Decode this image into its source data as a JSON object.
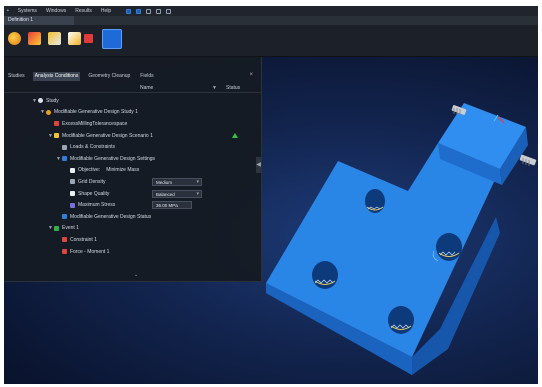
{
  "menubar": {
    "items": [
      "Systems",
      "Windows",
      "Results",
      "Help"
    ]
  },
  "ribbon": {
    "active_tab": "Definition 1"
  },
  "panel": {
    "tabs": [
      "Studies",
      "Analysis Conditions",
      "Geometry Cleanup",
      "Fields"
    ],
    "active_tab_index": 1,
    "close_glyph": "×",
    "columns": {
      "name": "Name",
      "status": "Status",
      "sort_glyph": "▼"
    },
    "collapse_glyph": "◀",
    "more_glyph": "⌄",
    "tree": [
      {
        "label": "Study",
        "indent": 0,
        "twisty": "▼",
        "icon": "study-icon",
        "color": "#d9e1ea"
      },
      {
        "label": "Modifiable Generative Design Study 1",
        "indent": 1,
        "twisty": "▼",
        "icon": "generative-study-icon",
        "color": "#e8a020"
      },
      {
        "label": "ExcessMillingTolerancespace",
        "indent": 2,
        "twisty": "",
        "icon": "tolerance-icon",
        "color": "#e0453a"
      },
      {
        "label": "Modifiable Generative Design Scenario 1",
        "indent": 2,
        "twisty": "▼",
        "icon": "scenario-icon",
        "color": "#f2c230",
        "status": "ok"
      },
      {
        "label": "Loads & Constraints",
        "indent": 3,
        "twisty": "",
        "icon": "loads-icon",
        "color": "#9aa6b4"
      },
      {
        "label": "Modifiable Generative Design Settings",
        "indent": 3,
        "twisty": "▼",
        "icon": "settings-icon",
        "color": "#2f7fd8"
      },
      {
        "label": "Objective:",
        "indent": 4,
        "twisty": "",
        "icon": "objective-icon",
        "color": "#e9eef4",
        "value": "Minimize Mass",
        "value_type": "text"
      },
      {
        "label": "Grid Density",
        "indent": 4,
        "twisty": "",
        "icon": "grid-icon",
        "color": "#9aa6b4",
        "value": "Medium",
        "value_type": "select"
      },
      {
        "label": "Shape Quality",
        "indent": 4,
        "twisty": "",
        "icon": "quality-icon",
        "color": "#e9eef4",
        "value": "Balanced",
        "value_type": "select"
      },
      {
        "label": "Maximum Stress",
        "indent": 4,
        "twisty": "",
        "icon": "stress-icon",
        "color": "#7a6ee0",
        "value": "36.00 MPa",
        "value_type": "input"
      },
      {
        "label": "Modifiable Generative Design Status",
        "indent": 3,
        "twisty": "",
        "icon": "status-icon",
        "color": "#2f7fd8"
      },
      {
        "label": "Event 1",
        "indent": 2,
        "twisty": "▼",
        "icon": "event-icon",
        "color": "#2fb24a"
      },
      {
        "label": "Constraint 1",
        "indent": 3,
        "twisty": "",
        "icon": "constraint-icon",
        "color": "#e0453a"
      },
      {
        "label": "Force - Moment 1",
        "indent": 3,
        "twisty": "",
        "icon": "force-icon",
        "color": "#e0453a"
      }
    ]
  },
  "colors": {
    "part_top": "#2a86e6",
    "part_side": "#1a64c0",
    "part_dark": "#0f4a99",
    "accent": "#2f7fd8",
    "status_ok": "#2fc24a"
  }
}
